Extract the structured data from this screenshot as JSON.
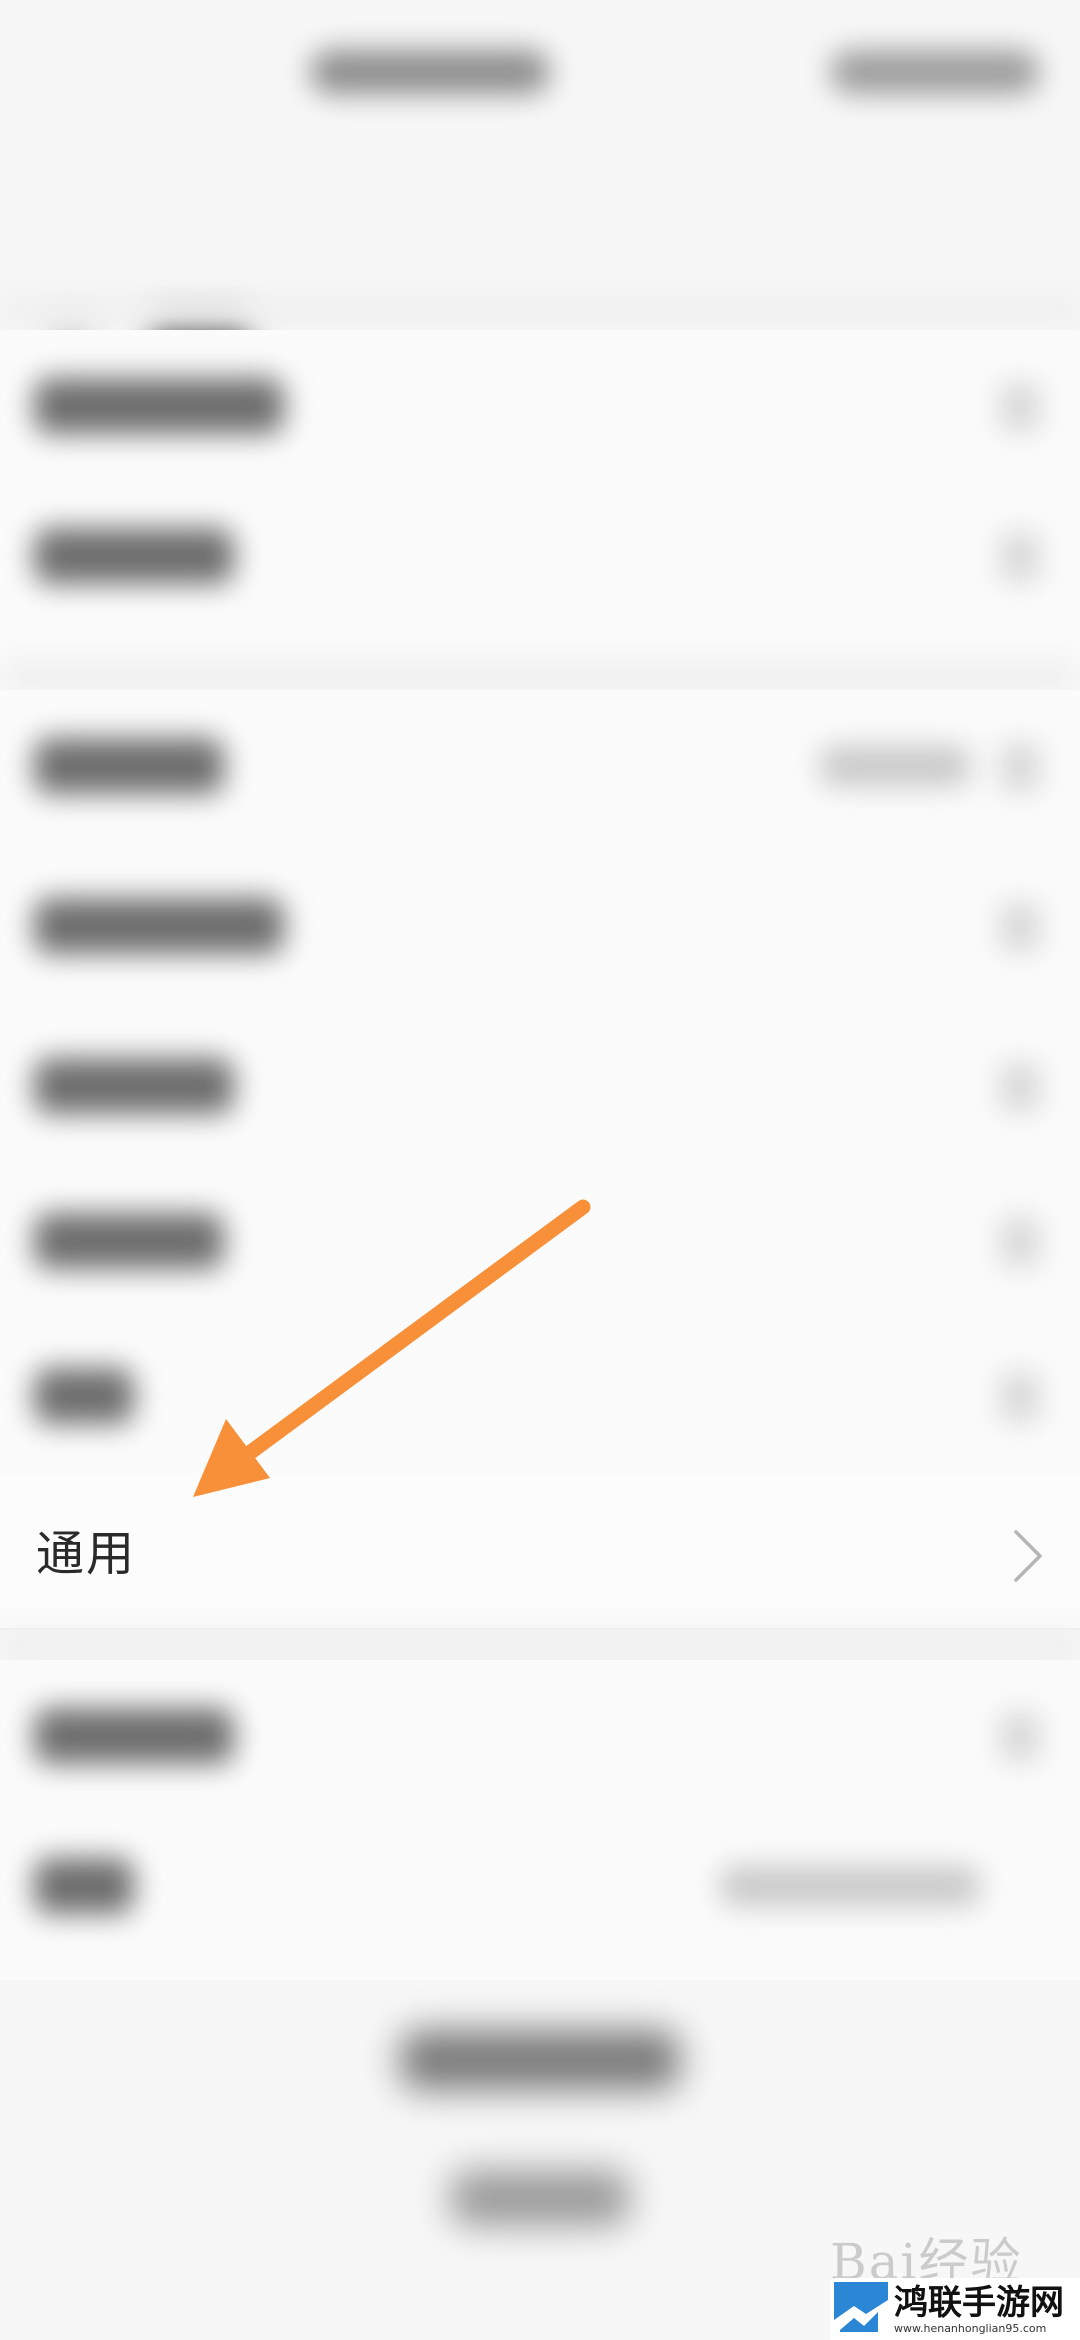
{
  "settings": {
    "general_label": "通用"
  },
  "watermark": {
    "baidu_text": "Bai经验",
    "site_name": "鸿联手游网",
    "site_url": "www.henanhonglian95.com"
  },
  "colors": {
    "arrow": "#f79038",
    "site_logo_blue": "#2b86d6"
  },
  "icons": {
    "general_chevron": "chevron-right-icon",
    "site_logo": "site-logo-icon"
  }
}
